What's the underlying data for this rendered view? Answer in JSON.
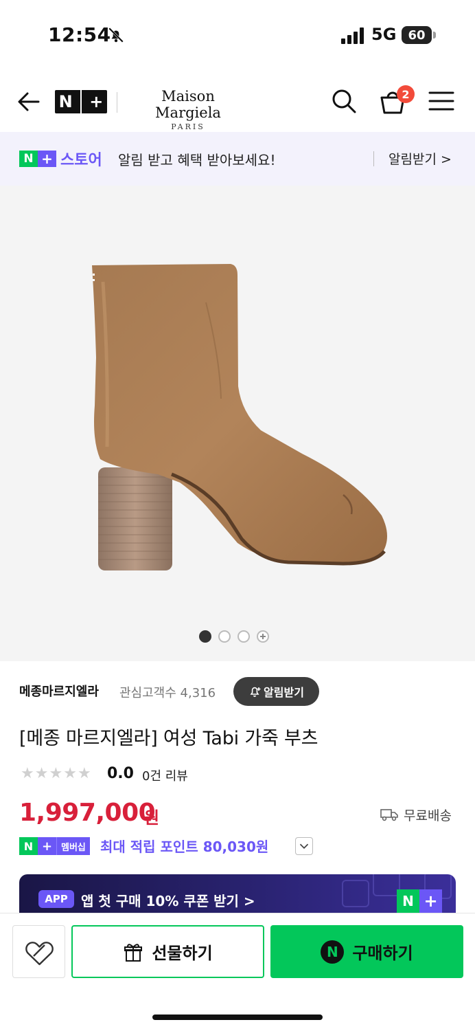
{
  "status_bar": {
    "time": "12:54",
    "network": "5G",
    "battery": "60"
  },
  "header": {
    "store_badge": [
      "N",
      "+"
    ],
    "brand_name": "Maison Margiela",
    "brand_sub": "PARIS",
    "cart_count": "2"
  },
  "notice": {
    "badge": [
      "N",
      "+"
    ],
    "store_label": "스토어",
    "message": "알림 받고 혜택 받아보세요!",
    "cta": "알림받기 >"
  },
  "gallery": {
    "current_index": 1,
    "total_dots": 3
  },
  "product": {
    "seller": "메종마르지엘라",
    "fans_label": "관심고객수 4,316",
    "alert_button": "알림받기",
    "title": "[메종 마르지엘라] 여성 Tabi 가죽 부츠",
    "stars": [
      "★",
      "★",
      "★",
      "★",
      "★"
    ],
    "rating": "0.0",
    "reviews": "0건 리뷰",
    "price": "1,997,000",
    "currency": "원",
    "shipping": "무료배송",
    "membership_badge": [
      "N",
      "+",
      "멤버십"
    ],
    "points": "최대 적립 포인트 80,030원"
  },
  "coupon": {
    "app_label": "APP",
    "text": "앱 첫 구매 10% 쿠폰 받기 >",
    "badge": [
      "N",
      "+"
    ]
  },
  "bottom_bar": {
    "gift_label": "선물하기",
    "buy_icon": "N",
    "buy_label": "구매하기"
  },
  "colors": {
    "naver_green": "#03c75a",
    "plus_purple": "#6b57f6",
    "price_red": "#d8203a"
  }
}
